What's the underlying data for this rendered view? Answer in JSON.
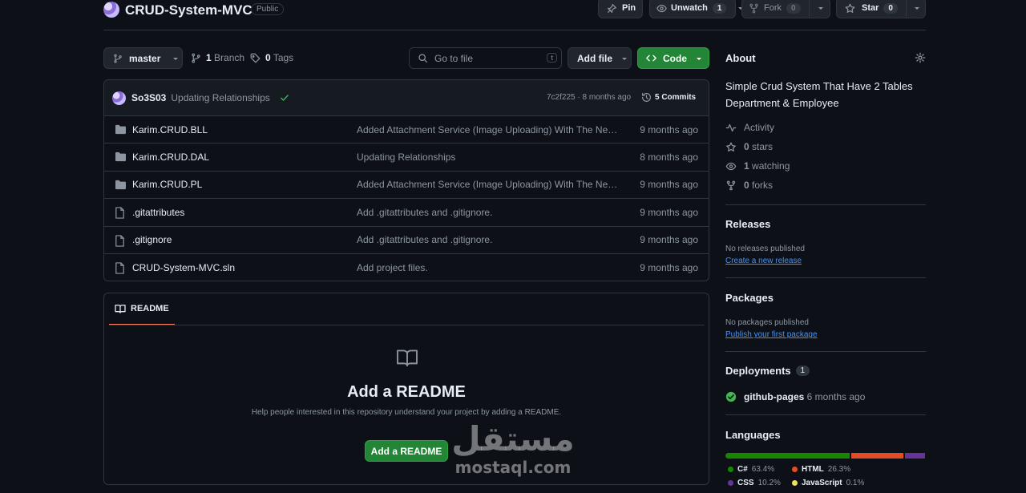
{
  "repo": {
    "name": "CRUD-System-MVC",
    "visibility": "Public"
  },
  "header_actions": {
    "pin": "Pin",
    "unwatch": "Unwatch",
    "watch_count": "1",
    "fork": "Fork",
    "fork_count": "0",
    "star": "Star",
    "star_count": "0"
  },
  "toolbar": {
    "branch": "master",
    "branches_count": "1",
    "branches_label": "Branch",
    "tags_count": "0",
    "tags_label": "Tags",
    "go_to_file_placeholder": "Go to file",
    "go_to_file_key": "t",
    "add_file": "Add file",
    "code": "Code"
  },
  "latest_commit": {
    "author": "So3S03",
    "message": "Updating Relationships",
    "hash": "7c2f225",
    "time": "· 8 months ago",
    "commits_count": "5 Commits"
  },
  "files": [
    {
      "type": "folder",
      "name": "Karim.CRUD.BLL",
      "message": "Added Attachment Service (Image Uploading) With The Necessary Changes",
      "time": "9 months ago"
    },
    {
      "type": "folder",
      "name": "Karim.CRUD.DAL",
      "message": "Updating Relationships",
      "time": "8 months ago"
    },
    {
      "type": "folder",
      "name": "Karim.CRUD.PL",
      "message": "Added Attachment Service (Image Uploading) With The Necessary Changes",
      "time": "9 months ago"
    },
    {
      "type": "file",
      "name": ".gitattributes",
      "message": "Add .gitattributes and .gitignore.",
      "time": "9 months ago"
    },
    {
      "type": "file",
      "name": ".gitignore",
      "message": "Add .gitattributes and .gitignore.",
      "time": "9 months ago"
    },
    {
      "type": "file",
      "name": "CRUD-System-MVC.sln",
      "message": "Add project files.",
      "time": "9 months ago"
    }
  ],
  "readme": {
    "tab": "README",
    "heading": "Add a README",
    "description": "Help people interested in this repository understand your project by adding a README.",
    "button": "Add a README"
  },
  "about": {
    "title": "About",
    "description": "Simple Crud System That Have 2 Tables Department & Employee",
    "activity": "Activity",
    "stars_count": "0",
    "stars_label": "stars",
    "watching_count": "1",
    "watching_label": "watching",
    "forks_count": "0",
    "forks_label": "forks"
  },
  "releases": {
    "title": "Releases",
    "empty": "No releases published",
    "link": "Create a new release"
  },
  "packages": {
    "title": "Packages",
    "empty": "No packages published",
    "link": "Publish your first package"
  },
  "deployments": {
    "title": "Deployments",
    "count": "1",
    "env": "github-pages",
    "time": "6 months ago"
  },
  "languages": {
    "title": "Languages",
    "items": [
      {
        "name": "C#",
        "percent": "63.4%",
        "value": 63.4,
        "color": "#178600"
      },
      {
        "name": "HTML",
        "percent": "26.3%",
        "value": 26.3,
        "color": "#e34c26"
      },
      {
        "name": "CSS",
        "percent": "10.2%",
        "value": 10.2,
        "color": "#663399"
      },
      {
        "name": "JavaScript",
        "percent": "0.1%",
        "value": 0.1,
        "color": "#f1e05a"
      }
    ]
  },
  "watermark": {
    "arabic": "مستقل",
    "latin": "mostaql.com"
  }
}
